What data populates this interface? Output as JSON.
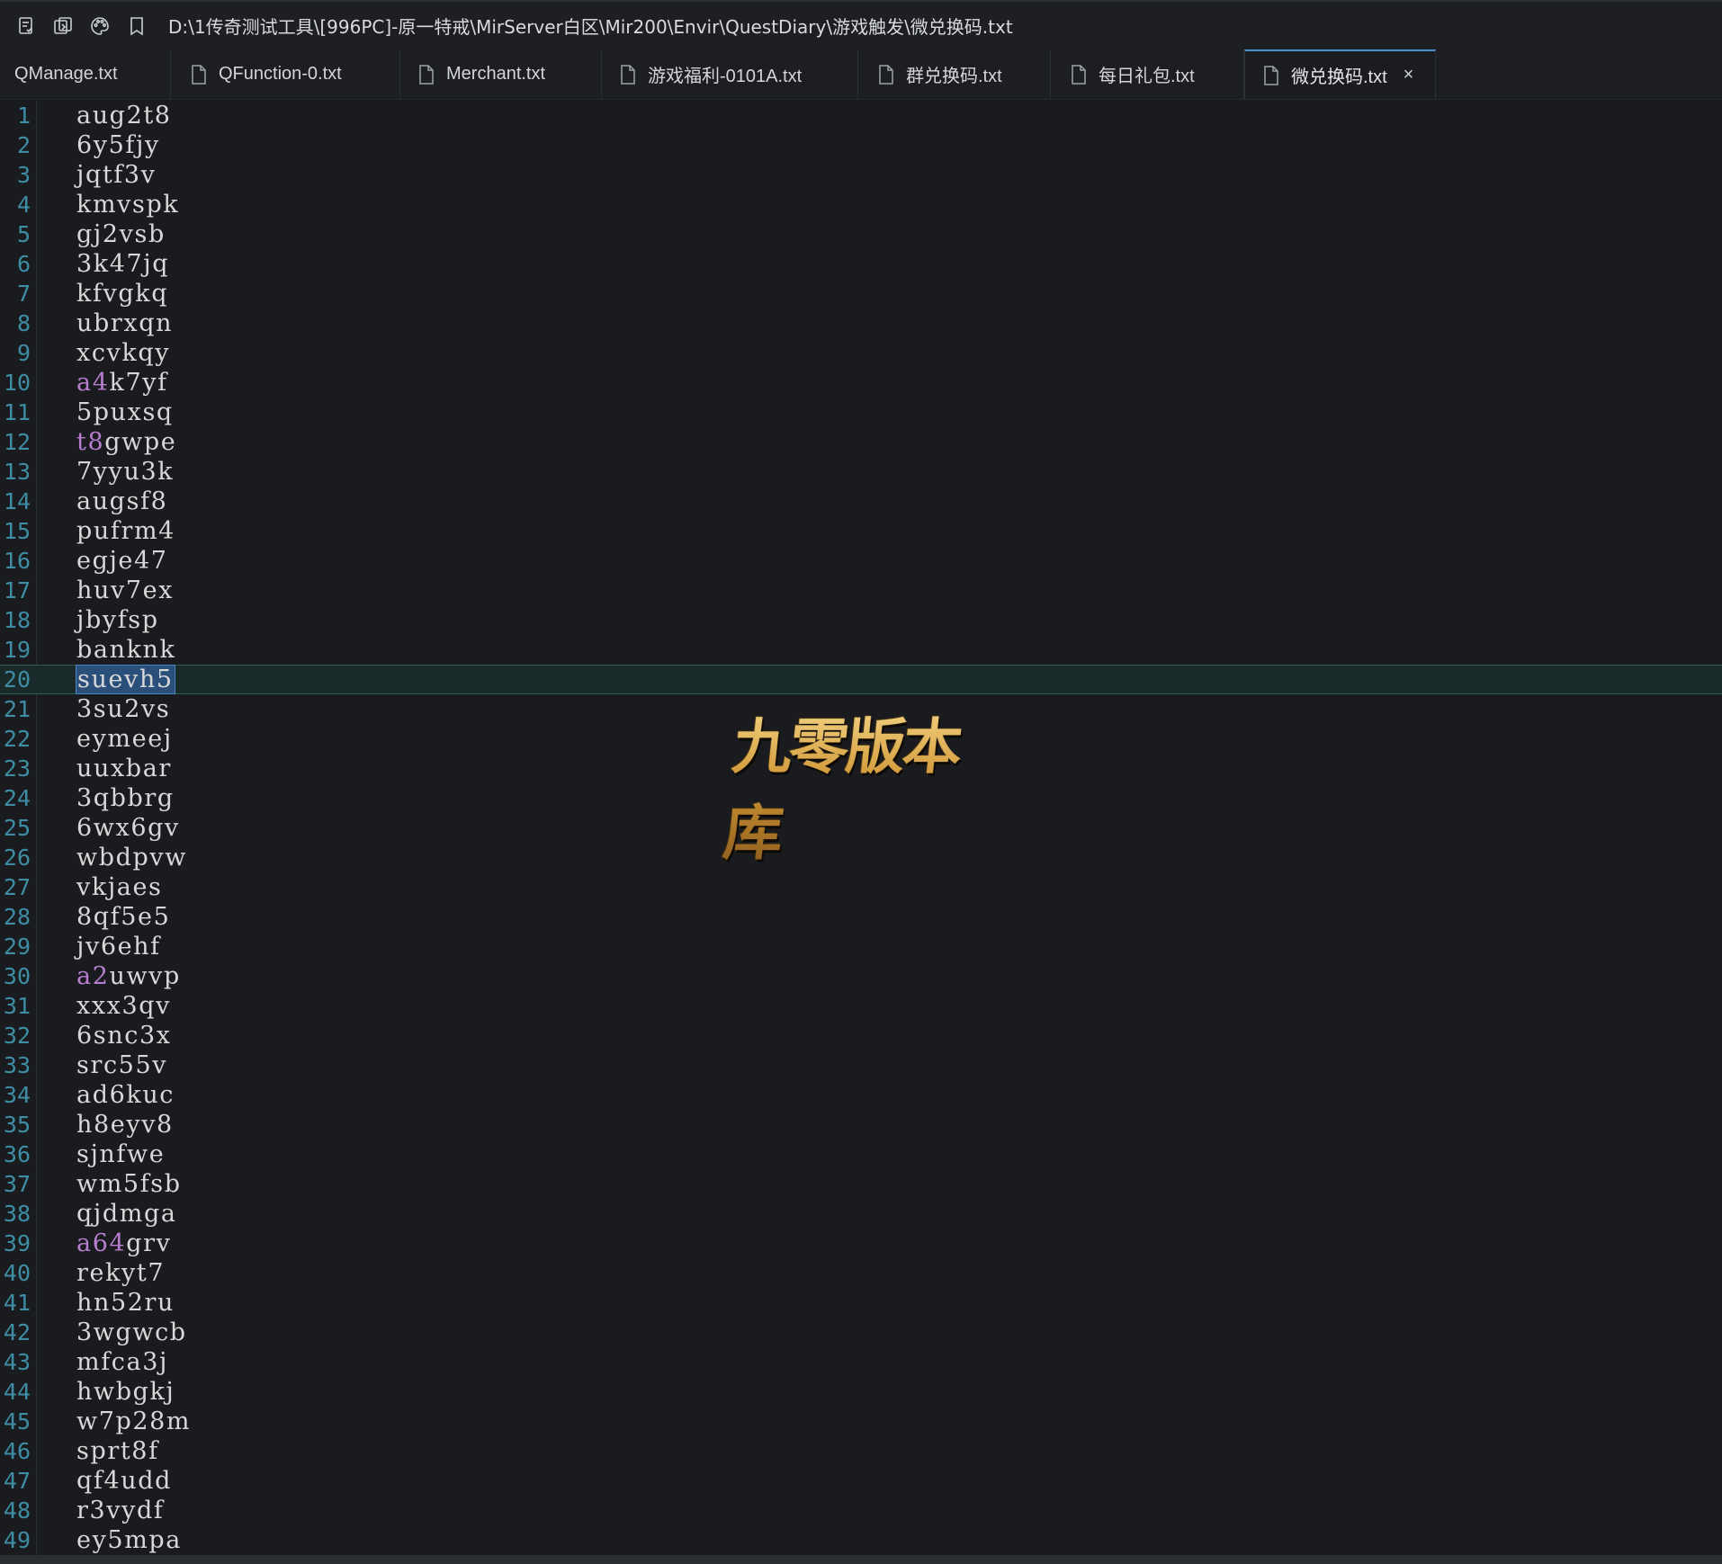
{
  "titlebar": {
    "icons": [
      "save-all-icon",
      "compare-icon",
      "palette-icon",
      "bookmark-icon"
    ],
    "path": "D:\\1传奇测试工具\\[996PC]-原一特戒\\MirServer白区\\Mir200\\Envir\\QuestDiary\\游戏触发\\微兑换码.txt"
  },
  "tabs": [
    {
      "label": "QManage.txt",
      "icon": false,
      "active": false
    },
    {
      "label": "QFunction-0.txt",
      "icon": true,
      "active": false
    },
    {
      "label": "Merchant.txt",
      "icon": true,
      "active": false
    },
    {
      "label": "游戏福利-0101A.txt",
      "icon": true,
      "active": false
    },
    {
      "label": "群兑换码.txt",
      "icon": true,
      "active": false
    },
    {
      "label": "每日礼包.txt",
      "icon": true,
      "active": false
    },
    {
      "label": "微兑换码.txt",
      "icon": true,
      "active": true,
      "close": "×"
    }
  ],
  "editor": {
    "current_line": 20,
    "lines": [
      {
        "n": "1",
        "text": "aug2t8"
      },
      {
        "n": "2",
        "text": "6y5fjy"
      },
      {
        "n": "3",
        "text": "jqtf3v"
      },
      {
        "n": "4",
        "text": "kmvspk"
      },
      {
        "n": "5",
        "text": "gj2vsb"
      },
      {
        "n": "6",
        "text": "3k47jq"
      },
      {
        "n": "7",
        "text": "kfvgkq"
      },
      {
        "n": "8",
        "text": "ubrxqn"
      },
      {
        "n": "9",
        "text": "xcvkqy"
      },
      {
        "n": "10",
        "text": "k7yf",
        "prefix": "a4"
      },
      {
        "n": "11",
        "text": "5puxsq"
      },
      {
        "n": "12",
        "text": "gwpe",
        "prefix": "t8"
      },
      {
        "n": "13",
        "text": "7yyu3k"
      },
      {
        "n": "14",
        "text": "augsf8"
      },
      {
        "n": "15",
        "text": "pufrm4"
      },
      {
        "n": "16",
        "text": "egje47"
      },
      {
        "n": "17",
        "text": "huv7ex"
      },
      {
        "n": "18",
        "text": "jbyfsp"
      },
      {
        "n": "19",
        "text": "banknk"
      },
      {
        "n": "20",
        "text": "suevh5",
        "selected": true
      },
      {
        "n": "21",
        "text": "3su2vs"
      },
      {
        "n": "22",
        "text": "eymeej"
      },
      {
        "n": "23",
        "text": "uuxbar"
      },
      {
        "n": "24",
        "text": "3qbbrg"
      },
      {
        "n": "25",
        "text": "6wx6gv"
      },
      {
        "n": "26",
        "text": "wbdpvw"
      },
      {
        "n": "27",
        "text": "vkjaes"
      },
      {
        "n": "28",
        "text": "8qf5e5"
      },
      {
        "n": "29",
        "text": "jv6ehf"
      },
      {
        "n": "30",
        "text": "uwvp",
        "prefix": "a2"
      },
      {
        "n": "31",
        "text": "xxx3qv"
      },
      {
        "n": "32",
        "text": "6snc3x"
      },
      {
        "n": "33",
        "text": "src55v"
      },
      {
        "n": "34",
        "text": "ad6kuc"
      },
      {
        "n": "35",
        "text": "h8eyv8"
      },
      {
        "n": "36",
        "text": "sjnfwe"
      },
      {
        "n": "37",
        "text": "wm5fsb"
      },
      {
        "n": "38",
        "text": "qjdmga"
      },
      {
        "n": "39",
        "text": "grv",
        "prefix": "a64"
      },
      {
        "n": "40",
        "text": "rekyt7"
      },
      {
        "n": "41",
        "text": "hn52ru"
      },
      {
        "n": "42",
        "text": "3wgwcb"
      },
      {
        "n": "43",
        "text": "mfca3j"
      },
      {
        "n": "44",
        "text": "hwbgkj"
      },
      {
        "n": "45",
        "text": "w7p28m"
      },
      {
        "n": "46",
        "text": "sprt8f"
      },
      {
        "n": "47",
        "text": "qf4udd"
      },
      {
        "n": "48",
        "text": "r3vydf"
      },
      {
        "n": "49",
        "text": "ey5mpa"
      }
    ]
  },
  "watermark": {
    "text": "九零版本库"
  },
  "colors": {
    "background": "#191b1f",
    "line_number": "#3e8da4",
    "text": "#d8d8d8",
    "highlight": "#b77ed0",
    "active_tab_accent": "#4a90d9",
    "current_line_border": "#2e5f56",
    "selection": "#2a4f7a"
  }
}
